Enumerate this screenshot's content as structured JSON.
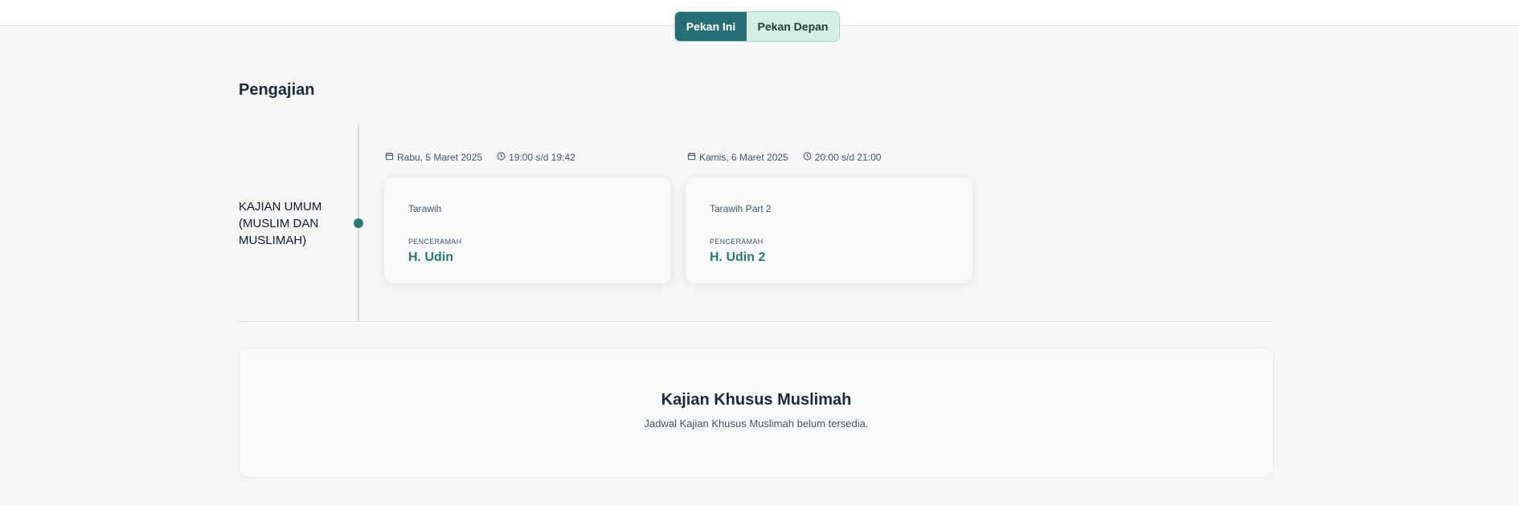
{
  "week_toggle": {
    "this_week": "Pekan Ini",
    "next_week": "Pekan Depan",
    "selected": "Pekan Ini"
  },
  "section": {
    "title": "Pengajian",
    "category": "KAJIAN UMUM (MUSLIM DAN MUSLIMAH)"
  },
  "events": [
    {
      "date": "Rabu, 5 Maret 2025",
      "time": "19:00 s/d 19:42",
      "name": "Tarawih",
      "role_label": "PENCERAMAH",
      "speaker": "H. Udin"
    },
    {
      "date": "Kamis, 6 Maret 2025",
      "time": "20:00 s/d 21:00",
      "name": "Tarawih Part 2",
      "role_label": "PENCERAMAH",
      "speaker": "H. Udin 2"
    }
  ],
  "empty_section": {
    "title": "Kajian Khusus Muslimah",
    "message": "Jadwal Kajian Khusus Muslimah belum tersedia."
  },
  "icons": {
    "date": "calendar-icon",
    "time": "clock-icon"
  },
  "colors": {
    "accent": "#266d74",
    "accent_light": "#d3efe4",
    "speaker": "#2a7a6f"
  }
}
